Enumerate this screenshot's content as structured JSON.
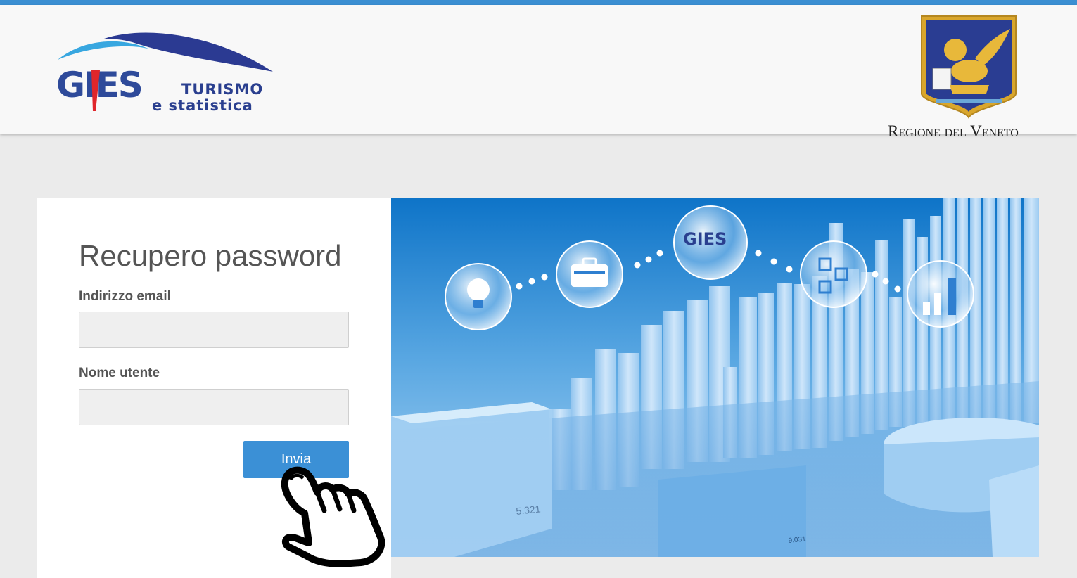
{
  "header": {
    "logo": {
      "brand": "GIES",
      "tagline_line1": "TURISMO",
      "tagline_line2": "e statistica"
    },
    "region": {
      "name": "Regione del Veneto"
    }
  },
  "form": {
    "title": "Recupero password",
    "email": {
      "label": "Indirizzo email",
      "value": "",
      "placeholder": ""
    },
    "username": {
      "label": "Nome utente",
      "value": "",
      "placeholder": ""
    },
    "submit_label": "Invia"
  },
  "hero": {
    "logo_text": "GIES",
    "values": [
      "5.321",
      "9.031"
    ],
    "icons": [
      "lightbulb-icon",
      "briefcase-icon",
      "gies-logo-icon",
      "network-icon",
      "bar-chart-icon"
    ]
  },
  "colors": {
    "accent": "#3b90d6",
    "top_bar": "#3b8fd2",
    "brand_navy": "#2a3f8f",
    "page_background": "#ebebeb"
  }
}
